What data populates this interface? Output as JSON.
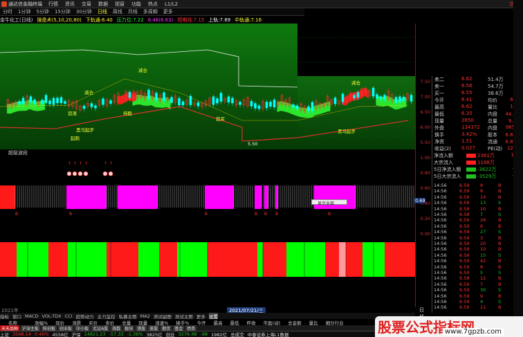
{
  "window": {
    "title": "通达信金融终端",
    "menu": [
      "行情",
      "资讯",
      "交易",
      "数据",
      "视窗",
      "功能",
      "热点",
      "L1/L2"
    ],
    "account": "交易"
  },
  "toolbar": {
    "items": [
      "分时",
      "1分钟",
      "5分钟",
      "15分钟",
      "30分钟",
      "日线",
      "周线",
      "月线",
      "多周期",
      "更多"
    ],
    "active_index": 5
  },
  "infobar": {
    "stock": "金牛化工(日线)",
    "tool": "操盘术(5,10,20,80)",
    "down_rail": "下轨通:6.40",
    "pressure": "压力位:7.22",
    "ma": "6.46(6.63)",
    "rail": "上轨:7.69",
    "mid_rail": "中轨通:7.16",
    "strong": "短期线:7.15"
  },
  "price_axis": [
    "7.50",
    "7.00",
    "6.50",
    "6.00",
    "5.50"
  ],
  "annotations": {
    "reduce_1": "减仓",
    "reduce_2": "减仓",
    "reduce_3": "减仓",
    "chase": "追涨",
    "low": "5.50",
    "start_1": "黑马起步",
    "start_2": "黑马起步",
    "ready": "起跑",
    "buy": "追买",
    "hold": "持股"
  },
  "indicator_title": "超级波段",
  "sub_axis": [
    "1.00",
    "0.80",
    "0.60",
    "0.40",
    "0.20",
    "0.00"
  ],
  "sub_marker": "0.69",
  "popup_label": "显示全部",
  "dates": {
    "start": "2021年",
    "cursor": "2021/07/21/三",
    "right": "日线"
  },
  "indicator_tabs": [
    "指标",
    "窗口",
    "MACD",
    "VOL-TDX",
    "CCI",
    "趋势动力",
    "主力监控",
    "私募主图",
    "MA2",
    "测试副图",
    "测试主图",
    "更多",
    "设置"
  ],
  "indicator_selected": 12,
  "table_header": [
    "名称",
    "涨幅%",
    "现价",
    "涨跌",
    "买价",
    "卖价",
    "总量",
    "现量",
    "涨速%",
    "换手%",
    "今开",
    "最高",
    "最低",
    "昨收",
    "市盈(动)",
    "总金额",
    "量比",
    "细分行业"
  ],
  "bottom_tabs": [
    "天天品种",
    "沪深主板",
    "科创板",
    "创业板",
    "中小板",
    "北证A股",
    "指数",
    "板块",
    "港股",
    "美股",
    "期货",
    "基金",
    "债券"
  ],
  "status": {
    "sh_label": "上证",
    "sh_value": "3568.14",
    "sh_chg": "0.46%",
    "sh_amt": "4558亿",
    "sz_label": "沪深",
    "sz_value": "14821.23",
    "sz_chg": "-57.33",
    "sz_pct": "-1.36%",
    "sz_amt": "3825亿",
    "cy_label": "创业",
    "cy_value": "3276.48",
    "cy_chg": "-98",
    "cy_amt": "1982亿",
    "total": "总成交",
    "broker": "中泰证券上海L1数据"
  },
  "quote": {
    "rows": [
      {
        "a": "卖二",
        "b": "6.62",
        "c": "51.4万",
        "d": ""
      },
      {
        "a": "卖一",
        "b": "6.56",
        "c": "54.7万",
        "d": ""
      },
      {
        "a": "买一",
        "b": "6.55",
        "c": "38.6万",
        "d": ""
      },
      {
        "a": "今开",
        "b": "6.41",
        "c": "均价",
        "d": "6.51"
      },
      {
        "a": "最高",
        "b": "6.62",
        "c": "量比",
        "d": "1.03"
      },
      {
        "a": "最低",
        "b": "6.35",
        "c": "内盘",
        "d": "44.9万"
      },
      {
        "a": "现量",
        "b": "2650",
        "c": "总量",
        "d": "9.0万"
      },
      {
        "a": "外盘",
        "b": "134372",
        "c": "内盘",
        "d": "98504"
      },
      {
        "a": "换手",
        "b": "3.42%",
        "c": "股本",
        "d": "6.80亿"
      },
      {
        "a": "净资",
        "b": "1.51",
        "c": "流通",
        "d": "6.80亿"
      },
      {
        "a": "收益(2)",
        "b": "0.027",
        "c": "PE(动)",
        "d": "122.6"
      }
    ]
  },
  "money_flow": [
    {
      "label": "净流入额",
      "bar_color": "#ff2020",
      "value": "2361万",
      "pct": "16%"
    },
    {
      "label": "大宗流入",
      "bar_color": "#ff2020",
      "value": "1188万",
      "pct": "3%"
    },
    {
      "label": "5日净流入额",
      "bar_color": "#20c020",
      "value": "-3622万",
      "pct": "-4%"
    },
    {
      "label": "5日大宗流入",
      "bar_color": "#20c020",
      "value": "-3529万",
      "pct": "-4%"
    }
  ],
  "ticks": [
    {
      "t": "14:56",
      "p": "6.59",
      "v": "8",
      "s": "B",
      "n": "3"
    },
    {
      "t": "14:56",
      "p": "6.59",
      "v": "8",
      "s": "B",
      "n": "5"
    },
    {
      "t": "14:56",
      "p": "6.59",
      "v": "14",
      "s": "B",
      "n": "3"
    },
    {
      "t": "14:56",
      "p": "6.59",
      "v": "13",
      "s": "S",
      "n": "4"
    },
    {
      "t": "14:56",
      "p": "6.59",
      "v": "10",
      "s": "B",
      "n": "4"
    },
    {
      "t": "14:56",
      "p": "6.58",
      "v": "7",
      "s": "S",
      "n": "5"
    },
    {
      "t": "14:56",
      "p": "6.59",
      "v": "26",
      "s": "B",
      "n": "7"
    },
    {
      "t": "14:56",
      "p": "6.59",
      "v": "6",
      "s": "B",
      "n": "2"
    },
    {
      "t": "14:56",
      "p": "6.59",
      "v": "27",
      "s": "S",
      "n": "9"
    },
    {
      "t": "14:56",
      "p": "6.59",
      "v": "3",
      "s": "B",
      "n": "1"
    },
    {
      "t": "14:56",
      "p": "6.59",
      "v": "20",
      "s": "B",
      "n": "6"
    },
    {
      "t": "14:56",
      "p": "6.59",
      "v": "10",
      "s": "B",
      "n": "3"
    },
    {
      "t": "14:56",
      "p": "6.58",
      "v": "15",
      "s": "S",
      "n": "4"
    },
    {
      "t": "14:56",
      "p": "6.59",
      "v": "42",
      "s": "B",
      "n": "8"
    },
    {
      "t": "14:56",
      "p": "6.59",
      "v": "8",
      "s": "B",
      "n": "2"
    },
    {
      "t": "14:56",
      "p": "6.59",
      "v": "5",
      "s": "S",
      "n": "1"
    },
    {
      "t": "14:56",
      "p": "6.58",
      "v": "12",
      "s": "B",
      "n": "3"
    },
    {
      "t": "14:56",
      "p": "6.59",
      "v": "7",
      "s": "B",
      "n": "2"
    },
    {
      "t": "14:56",
      "p": "6.59",
      "v": "30",
      "s": "S",
      "n": "6"
    },
    {
      "t": "14:56",
      "p": "6.59",
      "v": "9",
      "s": "B",
      "n": "2"
    },
    {
      "t": "14:56",
      "p": "6.59",
      "v": "4",
      "s": "S",
      "n": "1"
    },
    {
      "t": "14:56",
      "p": "6.59",
      "v": "11",
      "s": "B",
      "n": "3"
    }
  ],
  "watermark": {
    "title": "股票公式指标网",
    "url": "www.7gpzb.com"
  },
  "colors": {
    "up": "#ff3030",
    "down": "#20c020",
    "magenta": "#ff00ff",
    "sell_green": "#00ff00",
    "buy_red": "#ff2020"
  }
}
